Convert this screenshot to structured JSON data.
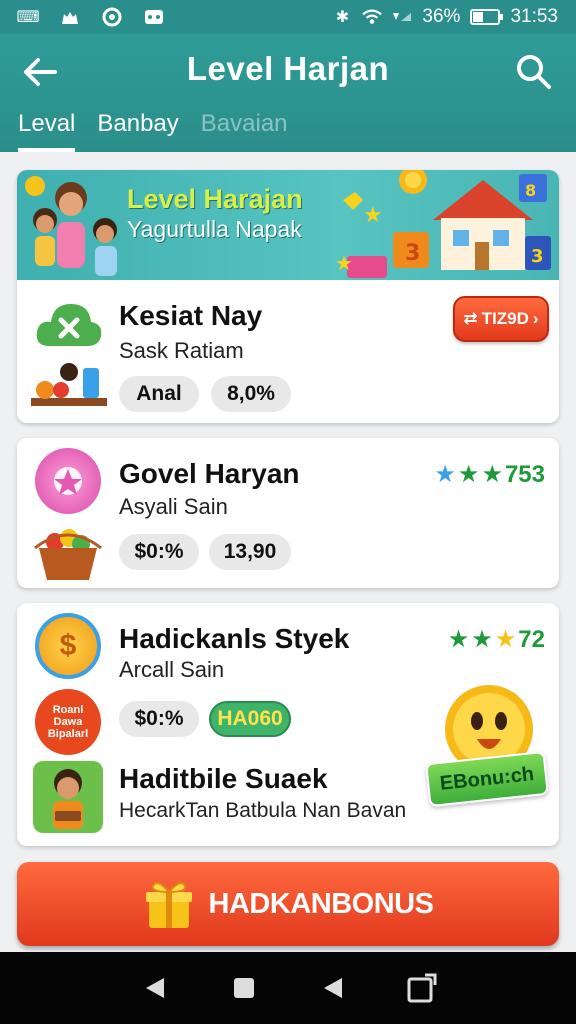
{
  "status": {
    "battery": "36%",
    "time": "31:53"
  },
  "appbar": {
    "title": "Level Harjan"
  },
  "tabs": [
    {
      "label": "Leval"
    },
    {
      "label": "Banbay"
    },
    {
      "label": "Bavaian"
    }
  ],
  "banner": {
    "title": "Level Harajan",
    "subtitle": "Yagurtulla Napak"
  },
  "cards": [
    {
      "title": "Kesiat Nay",
      "subtitle": "Sask Ratiam",
      "chips": [
        "Anal",
        "8,0%"
      ],
      "badge": "TIZ9D"
    },
    {
      "title": "Govel Haryan",
      "subtitle": "Asyali Sain",
      "chips": [
        "$0:%",
        "13,90"
      ],
      "rating": "753"
    },
    {
      "title": "Hadickanls Styek",
      "subtitle": "Arcall Sain",
      "chips": [
        "$0:%",
        "HA060"
      ],
      "rating": "72",
      "side_badge": "Roanl Dawa Bipalarl"
    }
  ],
  "extra": {
    "title": "Haditbile Suaek",
    "subtitle": "HecarkTan Batbula Nan Bavan",
    "badge": "EBonu:ch"
  },
  "cta": {
    "label": "HADKANBONUS"
  },
  "colors": {
    "teal": "#2b8e8a",
    "accent": "#e23a1c",
    "rating": "#1e9a3a"
  }
}
